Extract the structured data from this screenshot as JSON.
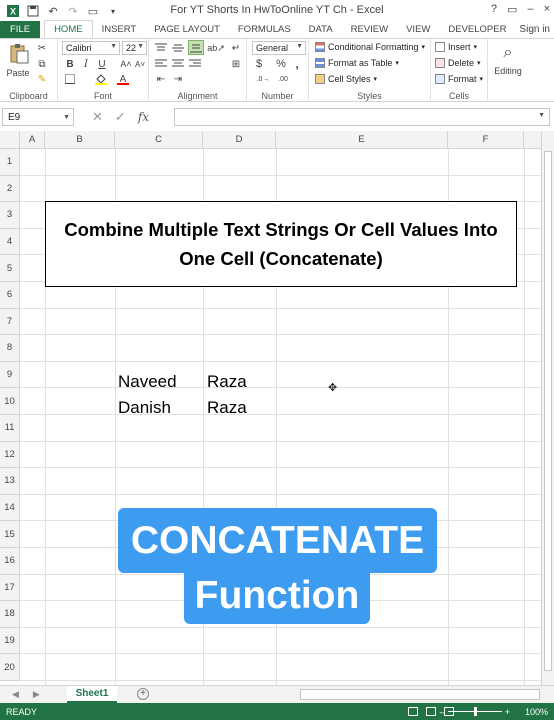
{
  "window": {
    "title": "For YT Shorts In HwToOnline YT Ch - Excel",
    "sign_in": "Sign in"
  },
  "ribbon_tabs": [
    "FILE",
    "HOME",
    "INSERT",
    "PAGE LAYOUT",
    "FORMULAS",
    "DATA",
    "REVIEW",
    "VIEW",
    "DEVELOPER"
  ],
  "ribbon": {
    "clipboard": {
      "label": "Clipboard",
      "paste": "Paste"
    },
    "font": {
      "label": "Font",
      "name": "Calibri",
      "size": "22"
    },
    "alignment": {
      "label": "Alignment"
    },
    "number": {
      "label": "Number",
      "format": "General",
      "currency": "$",
      "percent": "%",
      "comma": ","
    },
    "styles": {
      "label": "Styles",
      "conditional_formatting": "Conditional Formatting",
      "format_as_table": "Format as Table",
      "cell_styles": "Cell Styles"
    },
    "cells": {
      "label": "Cells",
      "insert": "Insert",
      "delete": "Delete",
      "format": "Format"
    },
    "editing": {
      "label": "Editing"
    }
  },
  "formula_bar": {
    "name_box": "E9",
    "formula": ""
  },
  "columns": [
    "A",
    "B",
    "C",
    "D",
    "E",
    "F"
  ],
  "rows": [
    "1",
    "2",
    "3",
    "4",
    "5",
    "6",
    "7",
    "8",
    "9",
    "10",
    "11",
    "12",
    "13",
    "14",
    "15",
    "16",
    "17",
    "18",
    "19",
    "20"
  ],
  "cells": {
    "C9": "Naveed",
    "D9": "Raza",
    "C10": "Danish",
    "D10": "Raza"
  },
  "title_box": {
    "line1": "Combine Multiple Text Strings Or Cell Values Into",
    "line2": "One Cell (Concatenate)"
  },
  "banner": {
    "line1": "CONCATENATE",
    "line2": "Function",
    "color": "#3d9bf0"
  },
  "sheet_tabs": [
    "Sheet1"
  ],
  "status": {
    "mode": "READY",
    "zoom": "100%"
  },
  "colors": {
    "excel_green": "#217346"
  }
}
